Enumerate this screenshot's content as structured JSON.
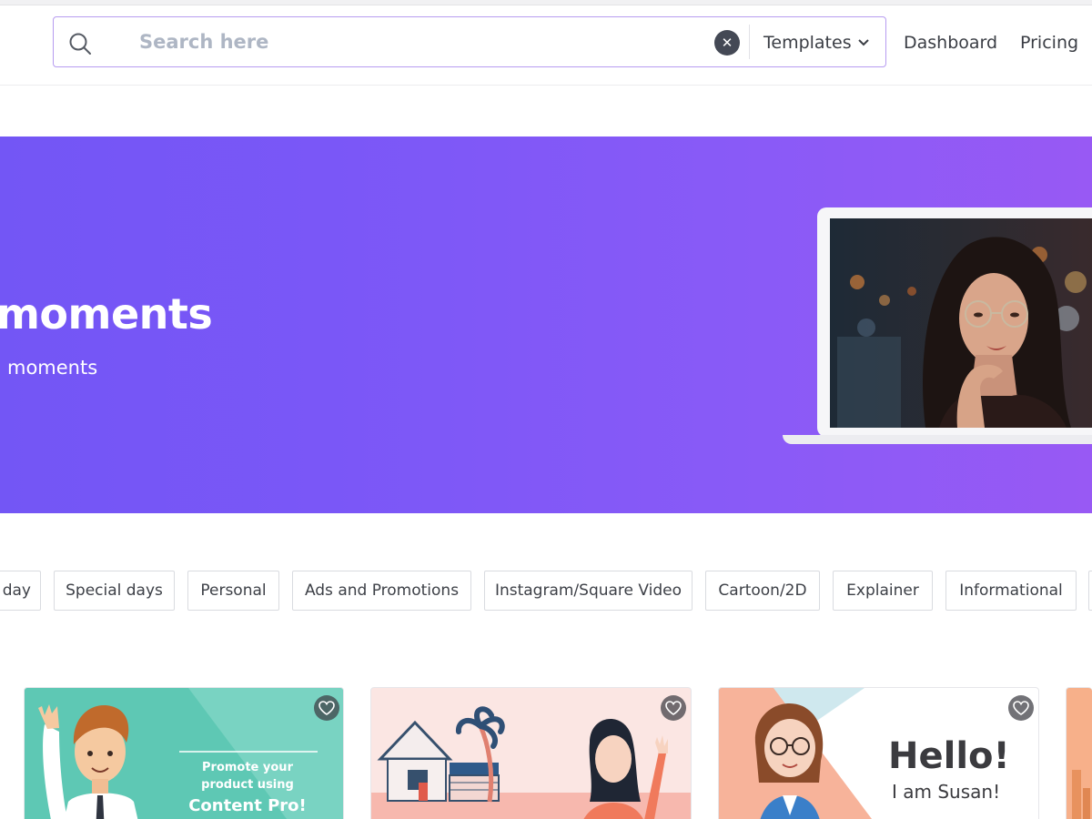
{
  "header": {
    "search": {
      "placeholder": "Search here",
      "clear_icon": "close-icon"
    },
    "templates_dropdown": {
      "label": "Templates"
    },
    "nav": [
      {
        "label": "Dashboard"
      },
      {
        "label": "Pricing"
      }
    ]
  },
  "hero": {
    "title": "moments",
    "subtitle": "moments",
    "background_gradient": [
      "#7356f5",
      "#9859f4"
    ]
  },
  "categories": [
    {
      "label": "day"
    },
    {
      "label": "Special days"
    },
    {
      "label": "Personal"
    },
    {
      "label": "Ads and Promotions"
    },
    {
      "label": "Instagram/Square Video"
    },
    {
      "label": "Cartoon/2D"
    },
    {
      "label": "Explainer"
    },
    {
      "label": "Informational"
    }
  ],
  "cards": [
    {
      "line1": "Promote your",
      "line2": "product using",
      "line3": "Content Pro!",
      "bg": "#5ec8b4"
    },
    {
      "caption": "",
      "bg": "#fbe6e3"
    },
    {
      "title": "Hello!",
      "subtitle": "I am Susan!",
      "bg": "#f7b39a"
    }
  ],
  "colors": {
    "accent": "#7a57f7",
    "search_border": "#b79cf0",
    "text_dark": "#3a3d44"
  }
}
